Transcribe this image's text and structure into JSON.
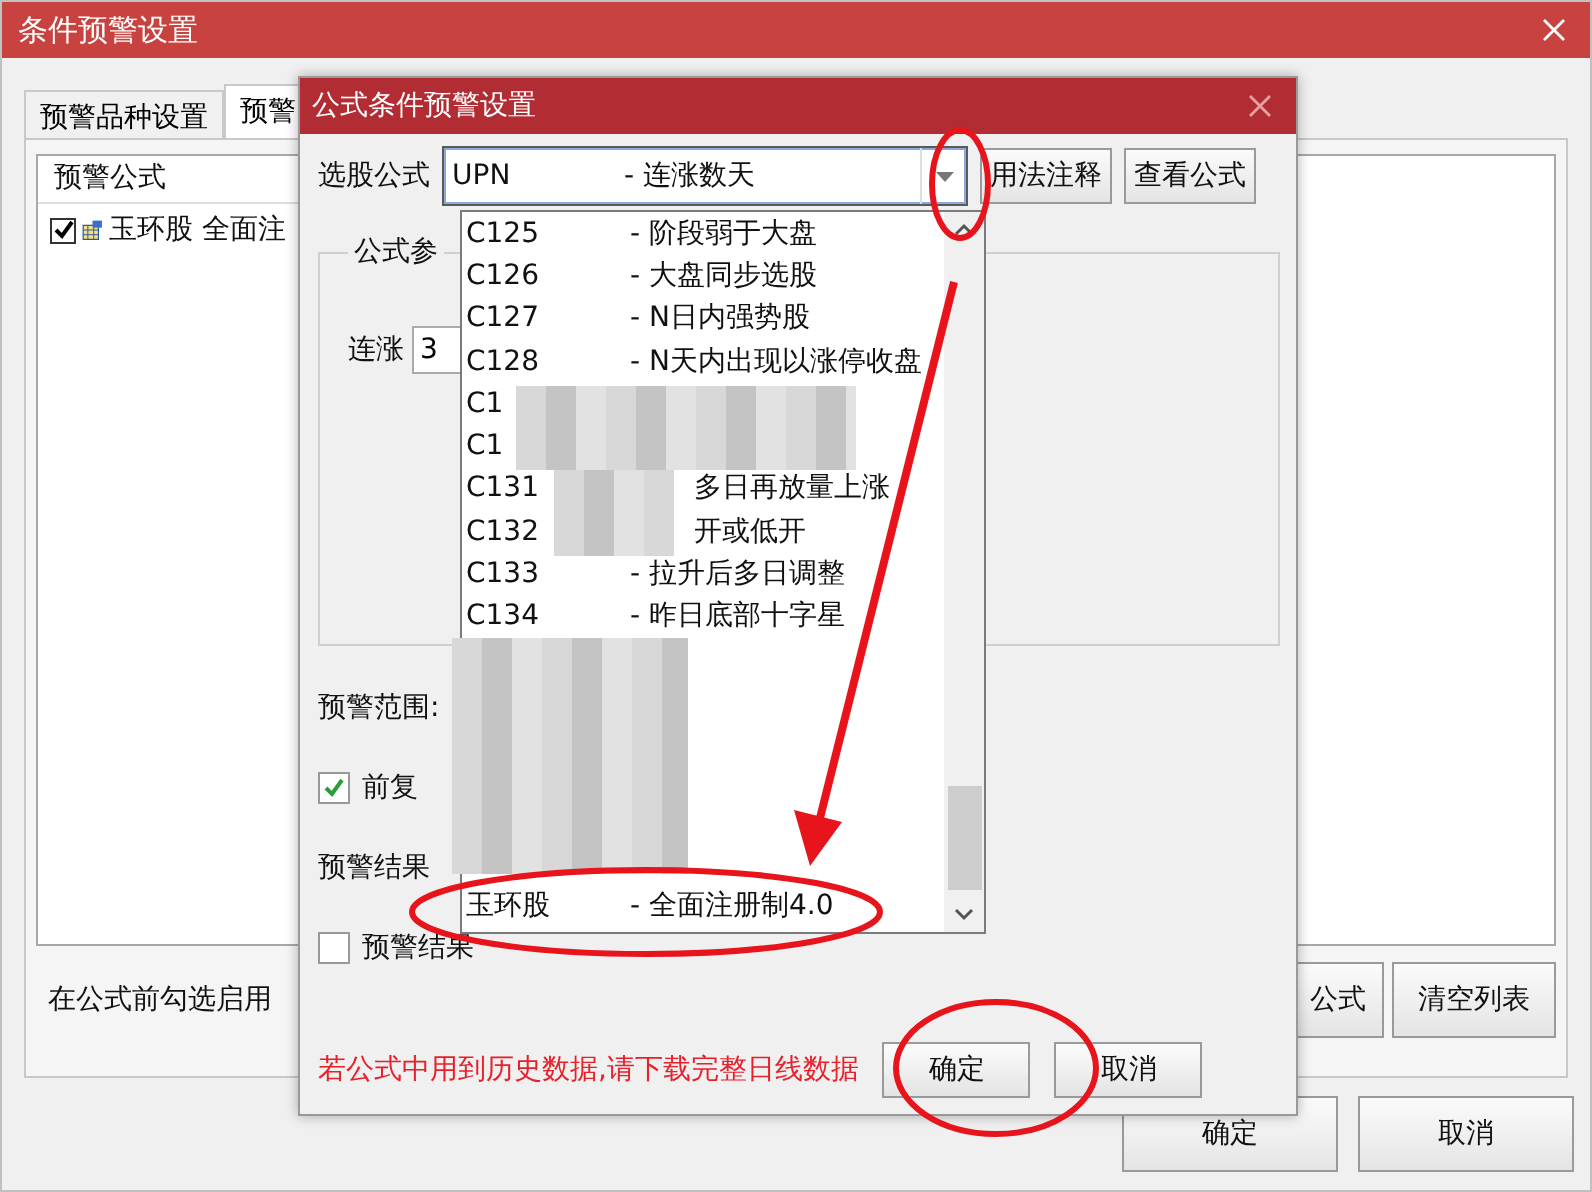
{
  "main_window": {
    "title": "条件预警设置",
    "tabs": [
      {
        "label": "预警品种设置",
        "selected": false
      },
      {
        "label": "预警",
        "selected": true
      }
    ],
    "formula_list": {
      "header": "预警公式",
      "rows": [
        {
          "checked": true,
          "text": "玉环股 全面注"
        }
      ]
    },
    "hint": "在公式前勾选启用",
    "panel_buttons": [
      "公式",
      "清空列表"
    ],
    "buttons": [
      "确定",
      "取消"
    ]
  },
  "dialog": {
    "title": "公式条件预警设置",
    "formula_label": "选股公式",
    "formula_value": {
      "code": "UPN",
      "desc": "- 连涨数天"
    },
    "side_buttons": [
      "用法注释",
      "查看公式"
    ],
    "params": {
      "legend": "公式参",
      "fields": [
        {
          "label": "连涨",
          "value": "3"
        }
      ]
    },
    "dropdown": {
      "expanded": true,
      "items": [
        {
          "kind": "full",
          "code": "C125",
          "desc": "- 阶段弱于大盘"
        },
        {
          "kind": "full",
          "code": "C126",
          "desc": "- 大盘同步选股"
        },
        {
          "kind": "full",
          "code": "C127",
          "desc": "- N日内强势股"
        },
        {
          "kind": "full",
          "code": "C128",
          "desc": "- N天内出现以涨停收盘"
        },
        {
          "kind": "code_only",
          "code": "C1"
        },
        {
          "kind": "code_only",
          "code": "C1"
        },
        {
          "kind": "partial",
          "code": "C131",
          "desc": "多日再放量上涨"
        },
        {
          "kind": "partial",
          "code": "C132",
          "desc": "开或低开"
        },
        {
          "kind": "full",
          "code": "C133",
          "desc": "- 拉升后多日调整"
        },
        {
          "kind": "full",
          "code": "C134",
          "desc": "- 昨日底部十字星"
        },
        {
          "kind": "last",
          "code": "玉环股",
          "desc": "- 全面注册制4.0"
        }
      ]
    },
    "range_label": "预警范围:",
    "adjust": {
      "label": "前复",
      "checked": true
    },
    "result_label": "预警结果",
    "result_option": {
      "label": "预警结果",
      "checked": false
    },
    "warning": "若公式中用到历史数据,请下载完整日线数据",
    "buttons": [
      "确定",
      "取消"
    ]
  }
}
